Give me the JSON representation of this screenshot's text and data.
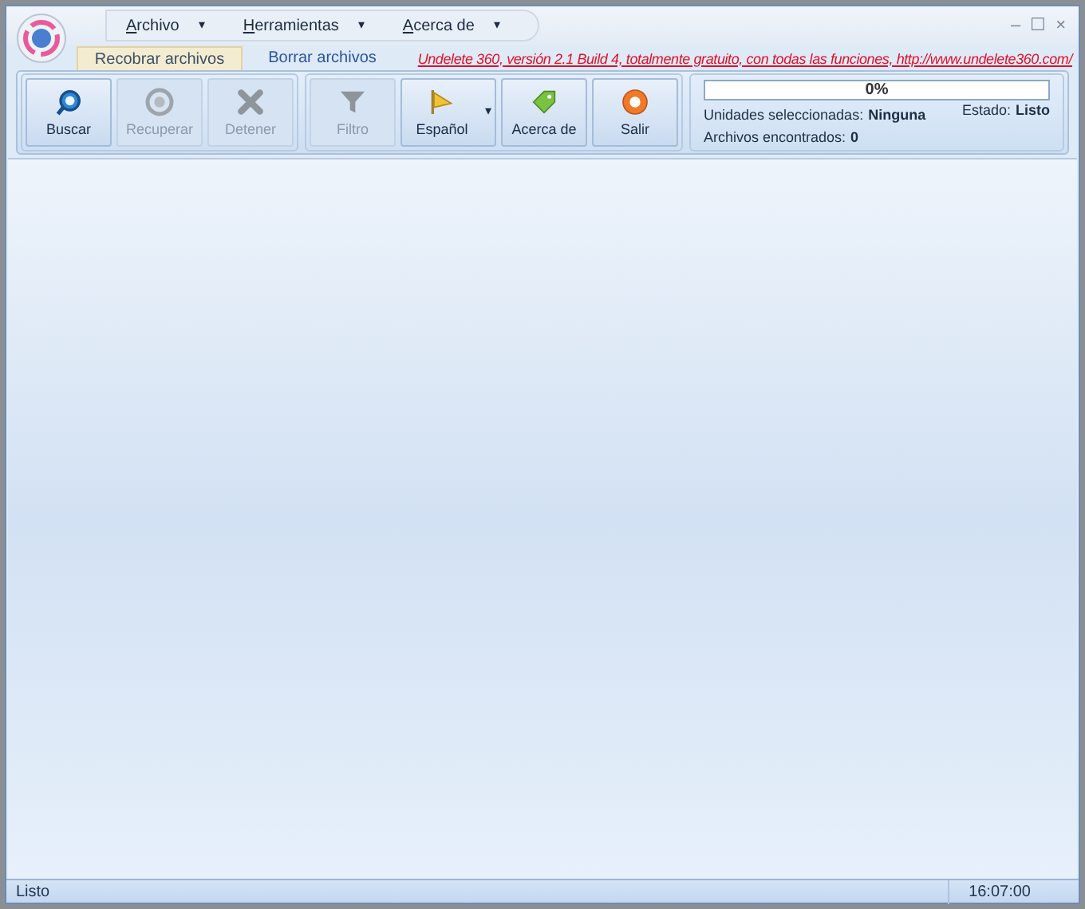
{
  "menu": [
    {
      "label": "Archivo",
      "caret": "▾"
    },
    {
      "label": "Herramientas",
      "caret": "▾"
    },
    {
      "label": "Acerca de",
      "caret": "▾"
    }
  ],
  "window_controls": [
    "–",
    "☐",
    "×"
  ],
  "tabs": [
    {
      "label": "Recobrar archivos",
      "selected": true
    },
    {
      "label": "Borrar archivos",
      "selected": false
    }
  ],
  "banner_link": "Undelete 360, versión 2.1 Build 4, totalmente gratuito, con todas las funciones, http://www.undelete360.com/",
  "ribbon_groups": [
    [
      {
        "label": "Buscar",
        "kind": "search",
        "disabled": false
      },
      {
        "label": "Recuperar",
        "kind": "recover",
        "disabled": true
      },
      {
        "label": "Detener",
        "kind": "stop",
        "disabled": true
      }
    ],
    [
      {
        "label": "Filtro",
        "kind": "filter",
        "disabled": true
      },
      {
        "label": "Español",
        "kind": "language",
        "disabled": false,
        "dropdown": "▾"
      },
      {
        "label": "Acerca de",
        "kind": "about",
        "disabled": false
      },
      {
        "label": "Salir",
        "kind": "exit",
        "disabled": false
      }
    ]
  ],
  "status_panel": {
    "progress": {
      "level": 0,
      "text": "0%"
    },
    "state_label": "Estado:",
    "state_value": "Listo",
    "drives_label": "Unidades seleccionadas:",
    "drives_value": "Ninguna",
    "found_label": "Archivos encontrados:",
    "found_value": "0"
  },
  "status_bar": {
    "text": "Listo",
    "time": "16:07:00"
  }
}
